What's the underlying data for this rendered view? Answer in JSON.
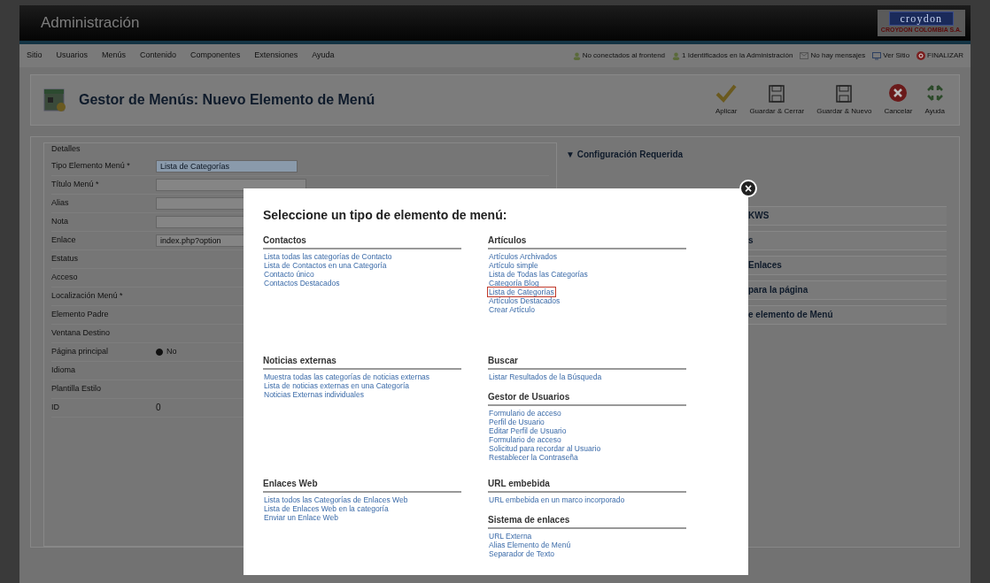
{
  "header": {
    "title": "Administración",
    "logo_top": "croydon",
    "logo_bottom": "CROYDON COLOMBIA S.A."
  },
  "menu": [
    "Sitio",
    "Usuarios",
    "Menús",
    "Contenido",
    "Componentes",
    "Extensiones",
    "Ayuda"
  ],
  "status": [
    {
      "kind": "user",
      "label": "No conectados al frontend"
    },
    {
      "kind": "user",
      "label": "1 Identificados en la Administración"
    },
    {
      "kind": "mail",
      "label": "No hay mensajes"
    },
    {
      "kind": "site",
      "label": "Ver Sitio"
    },
    {
      "kind": "logout",
      "label": "FINALIZAR"
    }
  ],
  "page_title": "Gestor de Menús: Nuevo Elemento de Menú",
  "toolbar": [
    {
      "kind": "apply",
      "label": "Aplicar"
    },
    {
      "kind": "save",
      "label": "Guardar & Cerrar"
    },
    {
      "kind": "save",
      "label": "Guardar & Nuevo"
    },
    {
      "kind": "cancel",
      "label": "Cancelar"
    },
    {
      "kind": "help",
      "label": "Ayuda"
    }
  ],
  "form": {
    "legend": "Detalles",
    "fields": [
      {
        "label": "Tipo Elemento Menú *",
        "kind": "select",
        "value": "Lista de Categorías"
      },
      {
        "label": "Título Menú *",
        "kind": "input"
      },
      {
        "label": "Alias",
        "kind": "input"
      },
      {
        "label": "Nota",
        "kind": "input"
      },
      {
        "label": "Enlace",
        "kind": "input",
        "value": "index.php?option"
      },
      {
        "label": "Estatus",
        "kind": "none"
      },
      {
        "label": "Acceso",
        "kind": "none"
      },
      {
        "label": "Localización Menú *",
        "kind": "none"
      },
      {
        "label": "Elemento Padre",
        "kind": "none"
      },
      {
        "label": "Ventana Destino",
        "kind": "none"
      },
      {
        "label": "Página principal",
        "kind": "radio",
        "value": "No",
        "checked": true
      },
      {
        "label": "Idioma",
        "kind": "none"
      },
      {
        "label": "Plantilla Estilo",
        "kind": "none"
      },
      {
        "label": "ID",
        "kind": "text",
        "value": "0"
      }
    ]
  },
  "side_panel": [
    {
      "label": "▼ Configuración Requerida",
      "kind": "head"
    },
    {
      "label": "KWS",
      "kind": "row"
    },
    {
      "label": "s",
      "kind": "row"
    },
    {
      "label": "Enlaces",
      "kind": "row"
    },
    {
      "label": "para la página",
      "kind": "row"
    },
    {
      "label": "e elemento de Menú",
      "kind": "row"
    }
  ],
  "modal": {
    "title": "Seleccione un tipo de elemento de menú:",
    "close": "×",
    "columns": [
      [
        [
          {
            "heading": "Contactos",
            "items": [
              {
                "label": "Lista todas las categorías de Contacto",
                "selected": false
              },
              {
                "label": "Lista de Contactos en una Categoría",
                "selected": false
              },
              {
                "label": "Contacto único",
                "selected": false
              },
              {
                "label": "Contactos Destacados",
                "selected": false
              }
            ]
          }
        ],
        [
          {
            "heading": "Noticias externas",
            "items": [
              {
                "label": "Muestra todas las categorías de noticias externas",
                "selected": false
              },
              {
                "label": "Lista de noticias externas en una Categoría",
                "selected": false
              },
              {
                "label": "Noticias Externas individuales",
                "selected": false
              }
            ]
          }
        ],
        [
          {
            "heading": "Enlaces Web",
            "items": [
              {
                "label": "Lista todos las Categorías de Enlaces Web",
                "selected": false
              },
              {
                "label": "Lista de Enlaces Web en la categoría",
                "selected": false
              },
              {
                "label": "Enviar un Enlace Web",
                "selected": false
              }
            ]
          }
        ]
      ],
      [
        [
          {
            "heading": "Artículos",
            "items": [
              {
                "label": "Artículos Archivados",
                "selected": false
              },
              {
                "label": "Artículo simple",
                "selected": false
              },
              {
                "label": "Lista de Todas las Categorías",
                "selected": false
              },
              {
                "label": "Categoría Blog",
                "selected": false
              },
              {
                "label": "Lista de Categorías",
                "selected": true
              },
              {
                "label": "Artículos Destacados",
                "selected": false
              },
              {
                "label": "Crear Artículo",
                "selected": false
              }
            ]
          }
        ],
        [
          {
            "heading": "Buscar",
            "items": [
              {
                "label": "Listar Resultados de la Búsqueda",
                "selected": false
              }
            ]
          },
          {
            "heading": "Gestor de Usuarios",
            "items": [
              {
                "label": "Formulario de acceso",
                "selected": false
              },
              {
                "label": "Perfil de Usuario",
                "selected": false
              },
              {
                "label": "Editar Perfil de Usuario",
                "selected": false
              },
              {
                "label": "Formulario de acceso",
                "selected": false
              },
              {
                "label": "Solicitud para recordar al Usuario",
                "selected": false
              },
              {
                "label": "Restablecer la Contraseña",
                "selected": false
              }
            ]
          }
        ],
        [
          {
            "heading": "URL embebida",
            "items": [
              {
                "label": "URL embebida en un marco incorporado",
                "selected": false
              }
            ]
          },
          {
            "heading": "Sistema de enlaces",
            "items": [
              {
                "label": "URL Externa",
                "selected": false
              },
              {
                "label": "Alias Elemento de Menú",
                "selected": false
              },
              {
                "label": "Separador de Texto",
                "selected": false
              }
            ]
          }
        ]
      ]
    ]
  }
}
